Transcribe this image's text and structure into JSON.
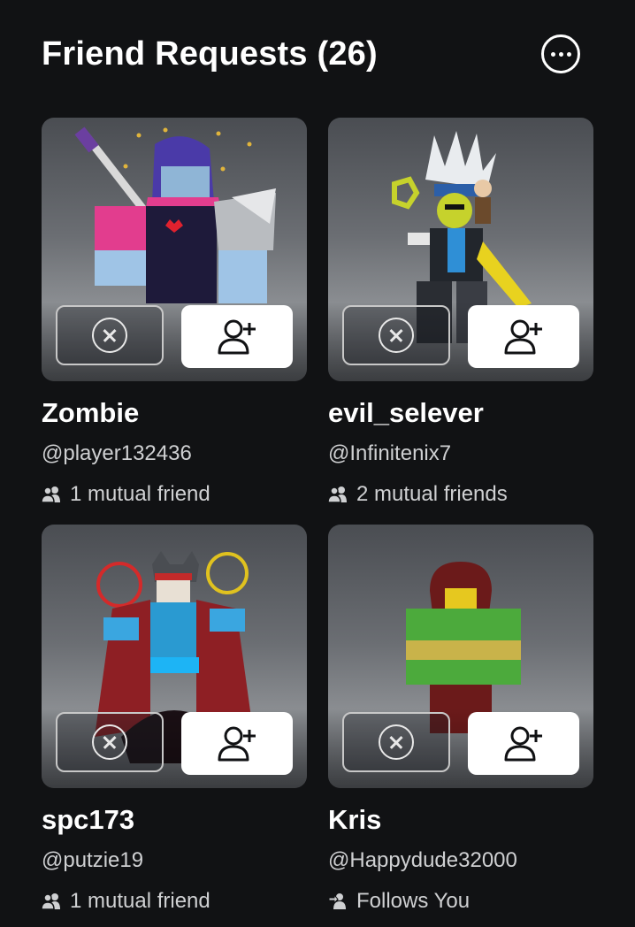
{
  "header": {
    "title": "Friend Requests (26)",
    "more_icon": "more-options-icon"
  },
  "requests": [
    {
      "display_name": "Zombie",
      "username": "@player132436",
      "meta_text": "1 mutual friend",
      "meta_icon": "mutual-friends-icon",
      "decline_icon": "close-circle-icon",
      "accept_icon": "add-friend-icon"
    },
    {
      "display_name": "evil_selever",
      "username": "@Infinitenix7",
      "meta_text": "2 mutual friends",
      "meta_icon": "mutual-friends-icon",
      "decline_icon": "close-circle-icon",
      "accept_icon": "add-friend-icon"
    },
    {
      "display_name": "spc173",
      "username": "@putzie19",
      "meta_text": "1 mutual friend",
      "meta_icon": "mutual-friends-icon",
      "decline_icon": "close-circle-icon",
      "accept_icon": "add-friend-icon"
    },
    {
      "display_name": "Kris",
      "username": "@Happydude32000",
      "meta_text": "Follows You",
      "meta_icon": "follows-you-icon",
      "decline_icon": "close-circle-icon",
      "accept_icon": "add-friend-icon"
    }
  ],
  "colors": {
    "background": "#111214",
    "text_primary": "#ffffff",
    "text_secondary": "#cfd0d2",
    "accept_button": "#ffffff"
  }
}
